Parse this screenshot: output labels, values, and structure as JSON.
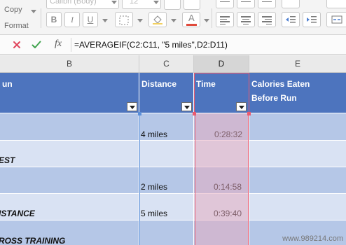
{
  "ribbon": {
    "copy_label": "Copy",
    "format_label": "Format",
    "font_name": "Calibri (Body)",
    "font_size": "12",
    "bold": "B",
    "italic": "I",
    "underline": "U"
  },
  "formula_bar": {
    "fx": "fx",
    "formula": "=AVERAGEIF(C2:C11, \"5 miles\",D2:D11)"
  },
  "columns": [
    "B",
    "C",
    "D",
    "E"
  ],
  "headers": {
    "b": "un",
    "c": "Distance",
    "d": "Time",
    "e_line1": "Calories Eaten",
    "e_line2": "Before Run"
  },
  "rows": [
    {
      "b": "",
      "c": "",
      "d": ""
    },
    {
      "b": "",
      "c": "4 miles",
      "d": "0:28:32"
    },
    {
      "b": "EST",
      "c": "",
      "d": ""
    },
    {
      "b": "",
      "c": "2 miles",
      "d": "0:14:58"
    },
    {
      "b": "ISTANCE",
      "c": "5 miles",
      "d": "0:39:40"
    },
    {
      "b": "ROSS TRAINING",
      "c": "",
      "d": ""
    }
  ],
  "watermark": "www.989214.com",
  "colors": {
    "header_fill": "#4d74be",
    "band_dark": "#b5c7e7",
    "band_light": "#d9e2f3",
    "selection": "#ea5a6f",
    "cancel": "#e0465c",
    "enter": "#3fa34d"
  }
}
